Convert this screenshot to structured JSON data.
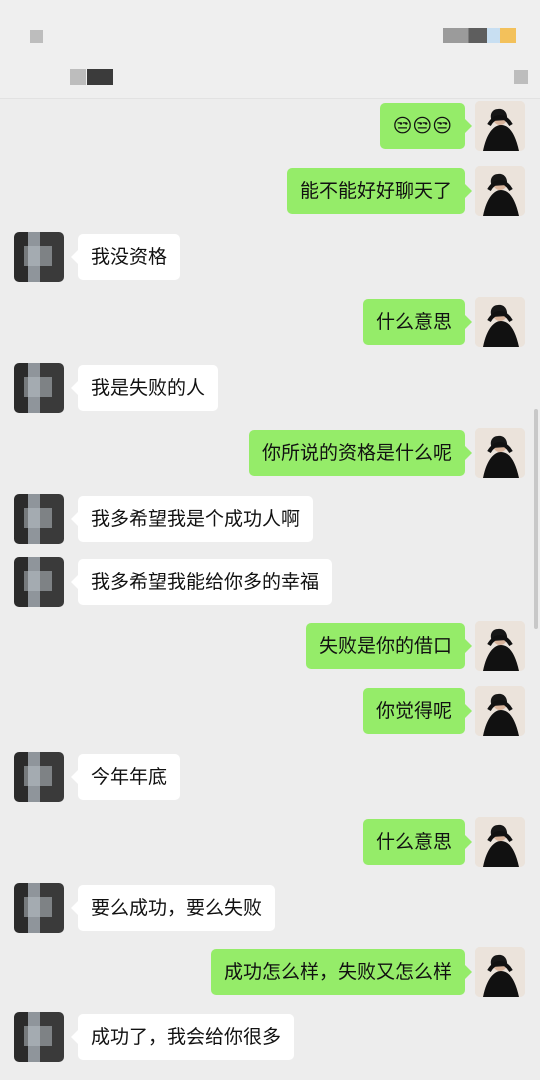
{
  "messages": [
    {
      "side": "sent",
      "text": "😒😒😒"
    },
    {
      "side": "sent",
      "text": "能不能好好聊天了"
    },
    {
      "side": "recv",
      "text": "我没资格"
    },
    {
      "side": "sent",
      "text": "什么意思"
    },
    {
      "side": "recv",
      "text": "我是失败的人"
    },
    {
      "side": "sent",
      "text": "你所说的资格是什么呢"
    },
    {
      "side": "recv",
      "text": "我多希望我是个成功人啊"
    },
    {
      "side": "recv",
      "text": "我多希望我能给你多的幸福"
    },
    {
      "side": "sent",
      "text": "失败是你的借口"
    },
    {
      "side": "sent",
      "text": "你觉得呢"
    },
    {
      "side": "recv",
      "text": "今年年底"
    },
    {
      "side": "sent",
      "text": "什么意思"
    },
    {
      "side": "recv",
      "text": "要么成功，要么失败"
    },
    {
      "side": "sent",
      "text": "成功怎么样，失败又怎么样"
    },
    {
      "side": "recv",
      "text": "成功了，我会给你很多"
    }
  ]
}
